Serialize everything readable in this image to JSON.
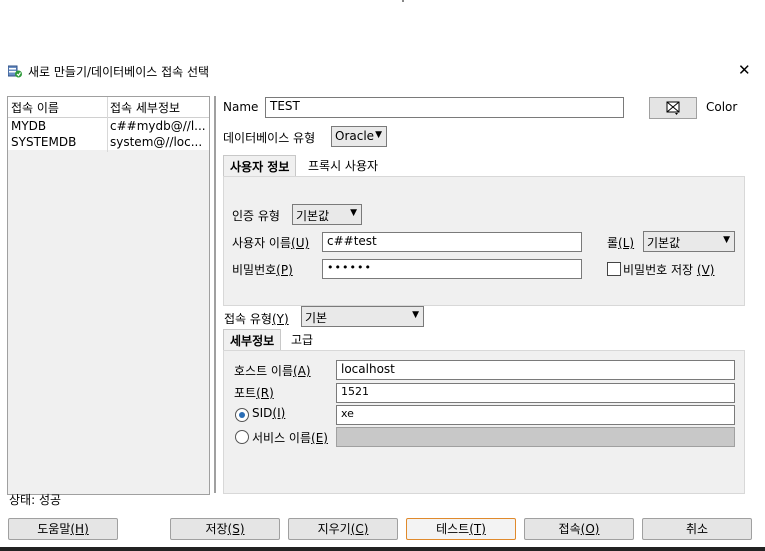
{
  "window": {
    "title": "새로 만들기/데이터베이스 접속 선택",
    "close_icon": "✕"
  },
  "connections": {
    "columns": [
      "접속 이름",
      "접속 세부정보"
    ],
    "rows": [
      [
        "MYDB",
        "c##mydb@//l..."
      ],
      [
        "SYSTEMDB",
        "system@//loc..."
      ]
    ]
  },
  "form": {
    "name_label": "Name",
    "name_value": "TEST",
    "color_label": "Color",
    "db_type_label": "데이터베이스 유형",
    "db_type_value": "Oracle",
    "tabs_top": [
      "사용자 정보",
      "프록시 사용자"
    ],
    "auth_type_label": "인증 유형",
    "auth_type_value": "기본값",
    "username_label": "사용자 이름",
    "username_mnemonic": "(U)",
    "username_value": "c##test",
    "role_label": "롤",
    "role_mnemonic": "(L)",
    "role_value": "기본값",
    "password_label": "비밀번호",
    "password_mnemonic": "(P)",
    "password_value": "••••••",
    "save_password_label": "비밀번호 저장",
    "save_password_mnemonic": "(V)",
    "save_password_checked": false,
    "conn_type_label": "접속 유형",
    "conn_type_mnemonic": "(Y)",
    "conn_type_value": "기본",
    "tabs_bottom": [
      "세부정보",
      "고급"
    ],
    "host_label": "호스트 이름",
    "host_mnemonic": "(A)",
    "host_value": "localhost",
    "port_label": "포트",
    "port_mnemonic": "(R)",
    "port_value": "1521",
    "sid_label": "SID",
    "sid_mnemonic": "(I)",
    "sid_value": "xe",
    "sid_selected": true,
    "service_label": "서비스 이름",
    "service_mnemonic": "(E)",
    "service_value": ""
  },
  "status": {
    "text": "상태: 성공"
  },
  "buttons": {
    "help": "도움말",
    "help_m": "(H)",
    "save": "저장",
    "save_m": "(S)",
    "clear": "지우기",
    "clear_m": "(C)",
    "test": "테스트",
    "test_m": "(T)",
    "connect": "접속",
    "connect_m": "(O)",
    "cancel": "취소"
  },
  "colors": {
    "accent": "#e08a2c",
    "radio": "#2a6db5",
    "panel": "#f0f0f0"
  }
}
